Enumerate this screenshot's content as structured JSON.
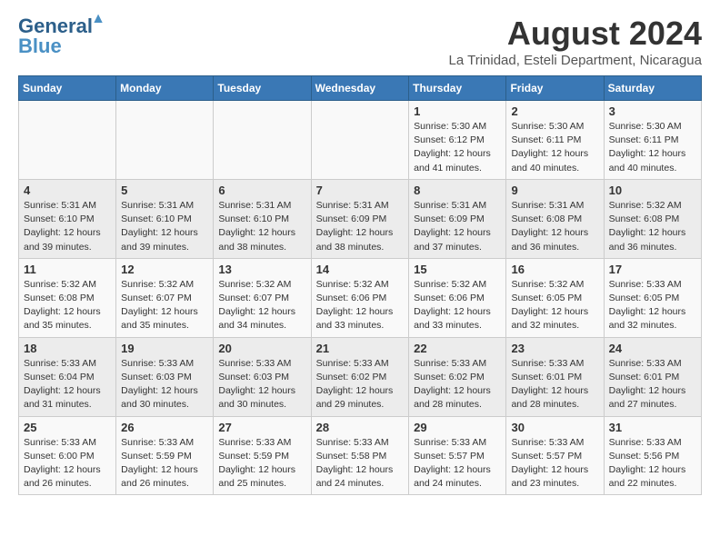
{
  "logo": {
    "line1": "General",
    "line2": "Blue"
  },
  "title": "August 2024",
  "subtitle": "La Trinidad, Esteli Department, Nicaragua",
  "days_of_week": [
    "Sunday",
    "Monday",
    "Tuesday",
    "Wednesday",
    "Thursday",
    "Friday",
    "Saturday"
  ],
  "weeks": [
    [
      {
        "day": "",
        "info": ""
      },
      {
        "day": "",
        "info": ""
      },
      {
        "day": "",
        "info": ""
      },
      {
        "day": "",
        "info": ""
      },
      {
        "day": "1",
        "info": "Sunrise: 5:30 AM\nSunset: 6:12 PM\nDaylight: 12 hours\nand 41 minutes."
      },
      {
        "day": "2",
        "info": "Sunrise: 5:30 AM\nSunset: 6:11 PM\nDaylight: 12 hours\nand 40 minutes."
      },
      {
        "day": "3",
        "info": "Sunrise: 5:30 AM\nSunset: 6:11 PM\nDaylight: 12 hours\nand 40 minutes."
      }
    ],
    [
      {
        "day": "4",
        "info": "Sunrise: 5:31 AM\nSunset: 6:10 PM\nDaylight: 12 hours\nand 39 minutes."
      },
      {
        "day": "5",
        "info": "Sunrise: 5:31 AM\nSunset: 6:10 PM\nDaylight: 12 hours\nand 39 minutes."
      },
      {
        "day": "6",
        "info": "Sunrise: 5:31 AM\nSunset: 6:10 PM\nDaylight: 12 hours\nand 38 minutes."
      },
      {
        "day": "7",
        "info": "Sunrise: 5:31 AM\nSunset: 6:09 PM\nDaylight: 12 hours\nand 38 minutes."
      },
      {
        "day": "8",
        "info": "Sunrise: 5:31 AM\nSunset: 6:09 PM\nDaylight: 12 hours\nand 37 minutes."
      },
      {
        "day": "9",
        "info": "Sunrise: 5:31 AM\nSunset: 6:08 PM\nDaylight: 12 hours\nand 36 minutes."
      },
      {
        "day": "10",
        "info": "Sunrise: 5:32 AM\nSunset: 6:08 PM\nDaylight: 12 hours\nand 36 minutes."
      }
    ],
    [
      {
        "day": "11",
        "info": "Sunrise: 5:32 AM\nSunset: 6:08 PM\nDaylight: 12 hours\nand 35 minutes."
      },
      {
        "day": "12",
        "info": "Sunrise: 5:32 AM\nSunset: 6:07 PM\nDaylight: 12 hours\nand 35 minutes."
      },
      {
        "day": "13",
        "info": "Sunrise: 5:32 AM\nSunset: 6:07 PM\nDaylight: 12 hours\nand 34 minutes."
      },
      {
        "day": "14",
        "info": "Sunrise: 5:32 AM\nSunset: 6:06 PM\nDaylight: 12 hours\nand 33 minutes."
      },
      {
        "day": "15",
        "info": "Sunrise: 5:32 AM\nSunset: 6:06 PM\nDaylight: 12 hours\nand 33 minutes."
      },
      {
        "day": "16",
        "info": "Sunrise: 5:32 AM\nSunset: 6:05 PM\nDaylight: 12 hours\nand 32 minutes."
      },
      {
        "day": "17",
        "info": "Sunrise: 5:33 AM\nSunset: 6:05 PM\nDaylight: 12 hours\nand 32 minutes."
      }
    ],
    [
      {
        "day": "18",
        "info": "Sunrise: 5:33 AM\nSunset: 6:04 PM\nDaylight: 12 hours\nand 31 minutes."
      },
      {
        "day": "19",
        "info": "Sunrise: 5:33 AM\nSunset: 6:03 PM\nDaylight: 12 hours\nand 30 minutes."
      },
      {
        "day": "20",
        "info": "Sunrise: 5:33 AM\nSunset: 6:03 PM\nDaylight: 12 hours\nand 30 minutes."
      },
      {
        "day": "21",
        "info": "Sunrise: 5:33 AM\nSunset: 6:02 PM\nDaylight: 12 hours\nand 29 minutes."
      },
      {
        "day": "22",
        "info": "Sunrise: 5:33 AM\nSunset: 6:02 PM\nDaylight: 12 hours\nand 28 minutes."
      },
      {
        "day": "23",
        "info": "Sunrise: 5:33 AM\nSunset: 6:01 PM\nDaylight: 12 hours\nand 28 minutes."
      },
      {
        "day": "24",
        "info": "Sunrise: 5:33 AM\nSunset: 6:01 PM\nDaylight: 12 hours\nand 27 minutes."
      }
    ],
    [
      {
        "day": "25",
        "info": "Sunrise: 5:33 AM\nSunset: 6:00 PM\nDaylight: 12 hours\nand 26 minutes."
      },
      {
        "day": "26",
        "info": "Sunrise: 5:33 AM\nSunset: 5:59 PM\nDaylight: 12 hours\nand 26 minutes."
      },
      {
        "day": "27",
        "info": "Sunrise: 5:33 AM\nSunset: 5:59 PM\nDaylight: 12 hours\nand 25 minutes."
      },
      {
        "day": "28",
        "info": "Sunrise: 5:33 AM\nSunset: 5:58 PM\nDaylight: 12 hours\nand 24 minutes."
      },
      {
        "day": "29",
        "info": "Sunrise: 5:33 AM\nSunset: 5:57 PM\nDaylight: 12 hours\nand 24 minutes."
      },
      {
        "day": "30",
        "info": "Sunrise: 5:33 AM\nSunset: 5:57 PM\nDaylight: 12 hours\nand 23 minutes."
      },
      {
        "day": "31",
        "info": "Sunrise: 5:33 AM\nSunset: 5:56 PM\nDaylight: 12 hours\nand 22 minutes."
      }
    ]
  ]
}
